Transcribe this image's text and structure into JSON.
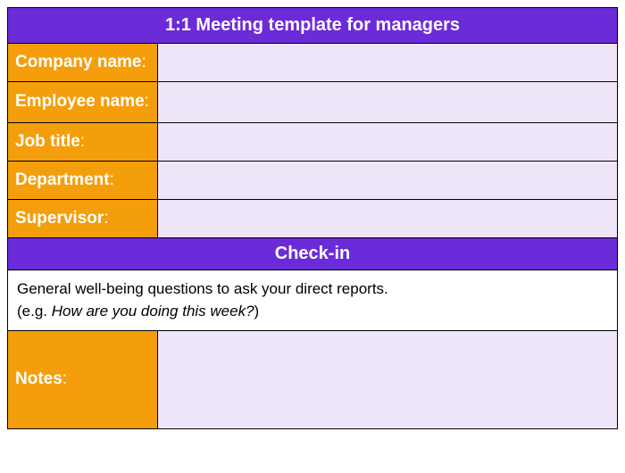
{
  "header": {
    "title": "1:1 Meeting template for managers"
  },
  "fields": {
    "company_name": {
      "label": "Company name",
      "value": ""
    },
    "employee_name": {
      "label": "Employee name",
      "value": ""
    },
    "job_title": {
      "label": "Job title",
      "value": ""
    },
    "department": {
      "label": "Department",
      "value": ""
    },
    "supervisor": {
      "label": "Supervisor",
      "value": ""
    }
  },
  "checkin": {
    "heading": "Check-in",
    "description": "General well-being questions to ask your direct reports.",
    "example_prefix": "(e.g. ",
    "example_text": "How are you doing this week?",
    "example_suffix": ")",
    "notes_label": "Notes",
    "notes_value": ""
  }
}
